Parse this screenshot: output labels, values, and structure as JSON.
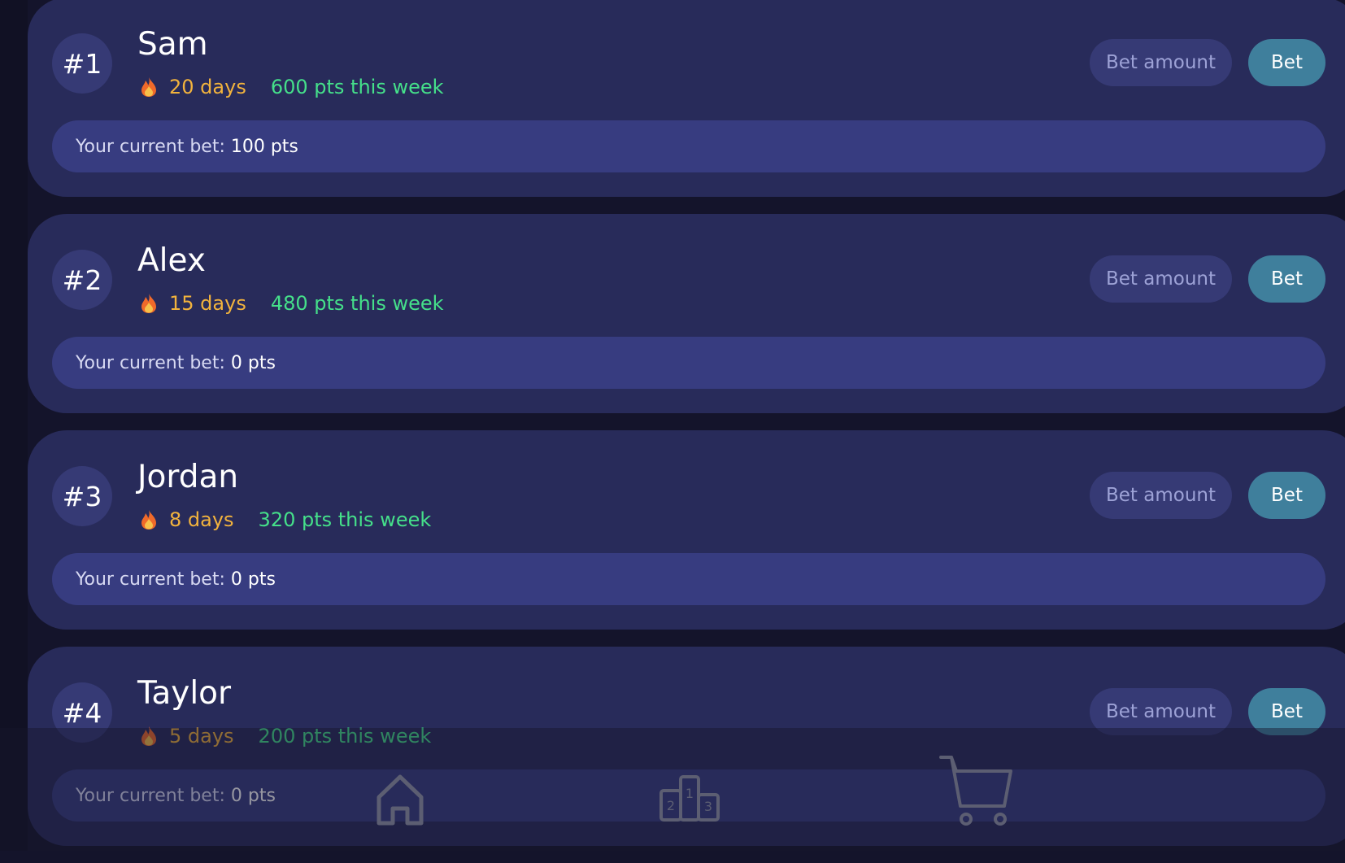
{
  "players": [
    {
      "rank": "#1",
      "name": "Sam",
      "streak": "20 days",
      "weekly": "600 pts this week",
      "bet_label": "Your current bet:",
      "bet_value": "100 pts"
    },
    {
      "rank": "#2",
      "name": "Alex",
      "streak": "15 days",
      "weekly": "480 pts this week",
      "bet_label": "Your current bet:",
      "bet_value": "0 pts"
    },
    {
      "rank": "#3",
      "name": "Jordan",
      "streak": "8 days",
      "weekly": "320 pts this week",
      "bet_label": "Your current bet:",
      "bet_value": "0 pts"
    },
    {
      "rank": "#4",
      "name": "Taylor",
      "streak": "5 days",
      "weekly": "200 pts this week",
      "bet_label": "Your current bet:",
      "bet_value": "0 pts"
    }
  ],
  "bet": {
    "placeholder": "Bet amount",
    "button_label": "Bet"
  },
  "podium": {
    "first": "1",
    "second": "2",
    "third": "3"
  },
  "nav": {
    "items": [
      "home-icon",
      "leaderboard-podium-icon",
      "shop-cart-icon"
    ]
  },
  "colors": {
    "background": "#14142b",
    "card": "#282b5a",
    "accent_button": "#3f7f9c",
    "streak": "#f2b33d",
    "weekly_points": "#45e08a"
  }
}
